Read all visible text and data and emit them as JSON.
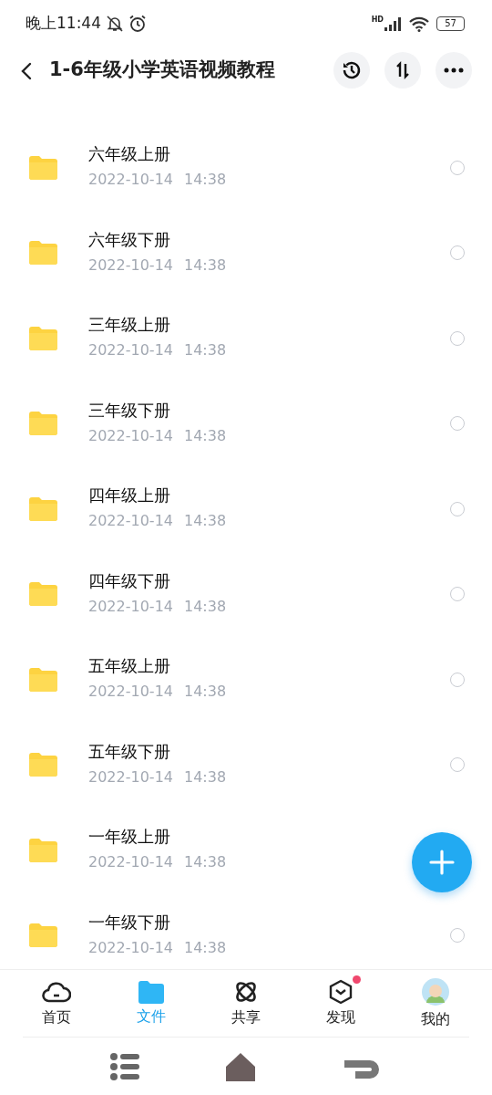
{
  "status_bar": {
    "time": "晚上11:44",
    "network": "HD",
    "battery": "57"
  },
  "header": {
    "title": "1-6年级小学英语视频教程"
  },
  "files": [
    {
      "name": "六年级上册",
      "date": "2022-10-14",
      "time": "14:38",
      "selected": false
    },
    {
      "name": "六年级下册",
      "date": "2022-10-14",
      "time": "14:38",
      "selected": false
    },
    {
      "name": "三年级上册",
      "date": "2022-10-14",
      "time": "14:38",
      "selected": false
    },
    {
      "name": "三年级下册",
      "date": "2022-10-14",
      "time": "14:38",
      "selected": false
    },
    {
      "name": "四年级上册",
      "date": "2022-10-14",
      "time": "14:38",
      "selected": false
    },
    {
      "name": "四年级下册",
      "date": "2022-10-14",
      "time": "14:38",
      "selected": false
    },
    {
      "name": "五年级上册",
      "date": "2022-10-14",
      "time": "14:38",
      "selected": false
    },
    {
      "name": "五年级下册",
      "date": "2022-10-14",
      "time": "14:38",
      "selected": false
    },
    {
      "name": "一年级上册",
      "date": "2022-10-14",
      "time": "14:38"
    },
    {
      "name": "一年级下册",
      "date": "2022-10-14",
      "time": "14:38",
      "selected": false
    }
  ],
  "tabs": [
    {
      "label": "首页",
      "kind": "home",
      "selected": false,
      "badge": false
    },
    {
      "label": "文件",
      "kind": "files",
      "selected": true,
      "badge": false
    },
    {
      "label": "共享",
      "kind": "share",
      "selected": false,
      "badge": false
    },
    {
      "label": "发现",
      "kind": "discover",
      "selected": false,
      "badge": true
    },
    {
      "label": "我的",
      "kind": "profile",
      "selected": false,
      "badge": false
    }
  ]
}
